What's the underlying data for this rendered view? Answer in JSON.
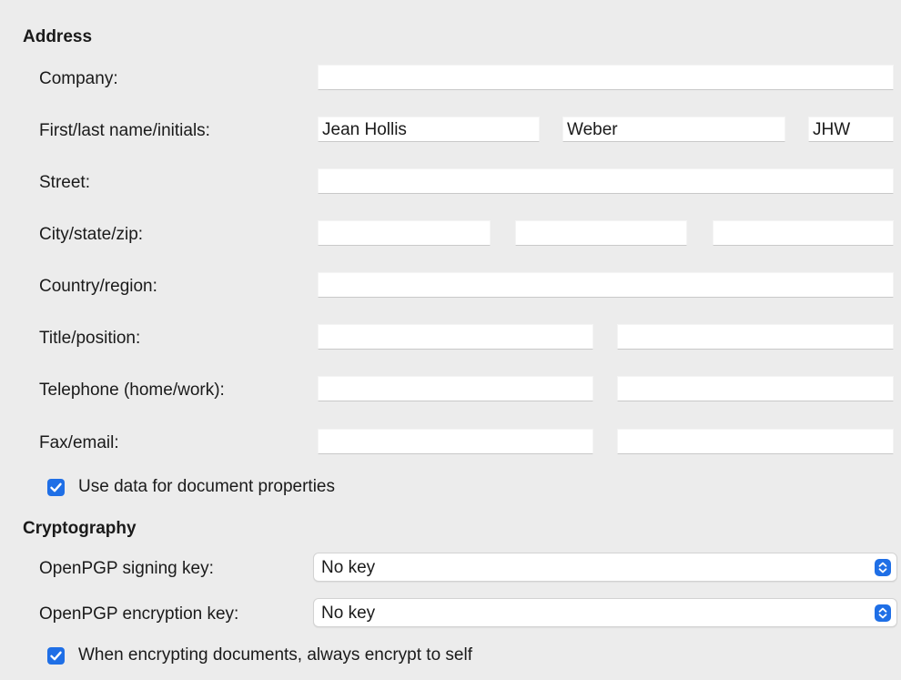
{
  "address": {
    "title": "Address",
    "company": {
      "label": "Company:",
      "value": ""
    },
    "name": {
      "label": "First/last name/initials:",
      "first": "Jean Hollis",
      "last": "Weber",
      "initials": "JHW"
    },
    "street": {
      "label": "Street:",
      "value": ""
    },
    "city_state_zip": {
      "label": "City/state/zip:",
      "city": "",
      "state": "",
      "zip": ""
    },
    "country": {
      "label": "Country/region:",
      "value": ""
    },
    "title_position": {
      "label": "Title/position:",
      "title": "",
      "position": ""
    },
    "telephone": {
      "label": "Telephone (home/work):",
      "home": "",
      "work": ""
    },
    "fax_email": {
      "label": "Fax/email:",
      "fax": "",
      "email": ""
    },
    "use_data": {
      "label": "Use data for document properties",
      "checked": true
    }
  },
  "cryptography": {
    "title": "Cryptography",
    "signing": {
      "label": "OpenPGP signing key:",
      "value": "No key"
    },
    "encryption": {
      "label": "OpenPGP encryption key:",
      "value": "No key"
    },
    "encrypt_self": {
      "label": "When encrypting documents, always encrypt to self",
      "checked": true
    }
  },
  "colors": {
    "accent": "#1f6fe6",
    "background": "#ececec",
    "field": "#ffffff"
  },
  "icons": {
    "checkbox": "checkmark-icon",
    "select": "up-down-chevron-icon"
  }
}
